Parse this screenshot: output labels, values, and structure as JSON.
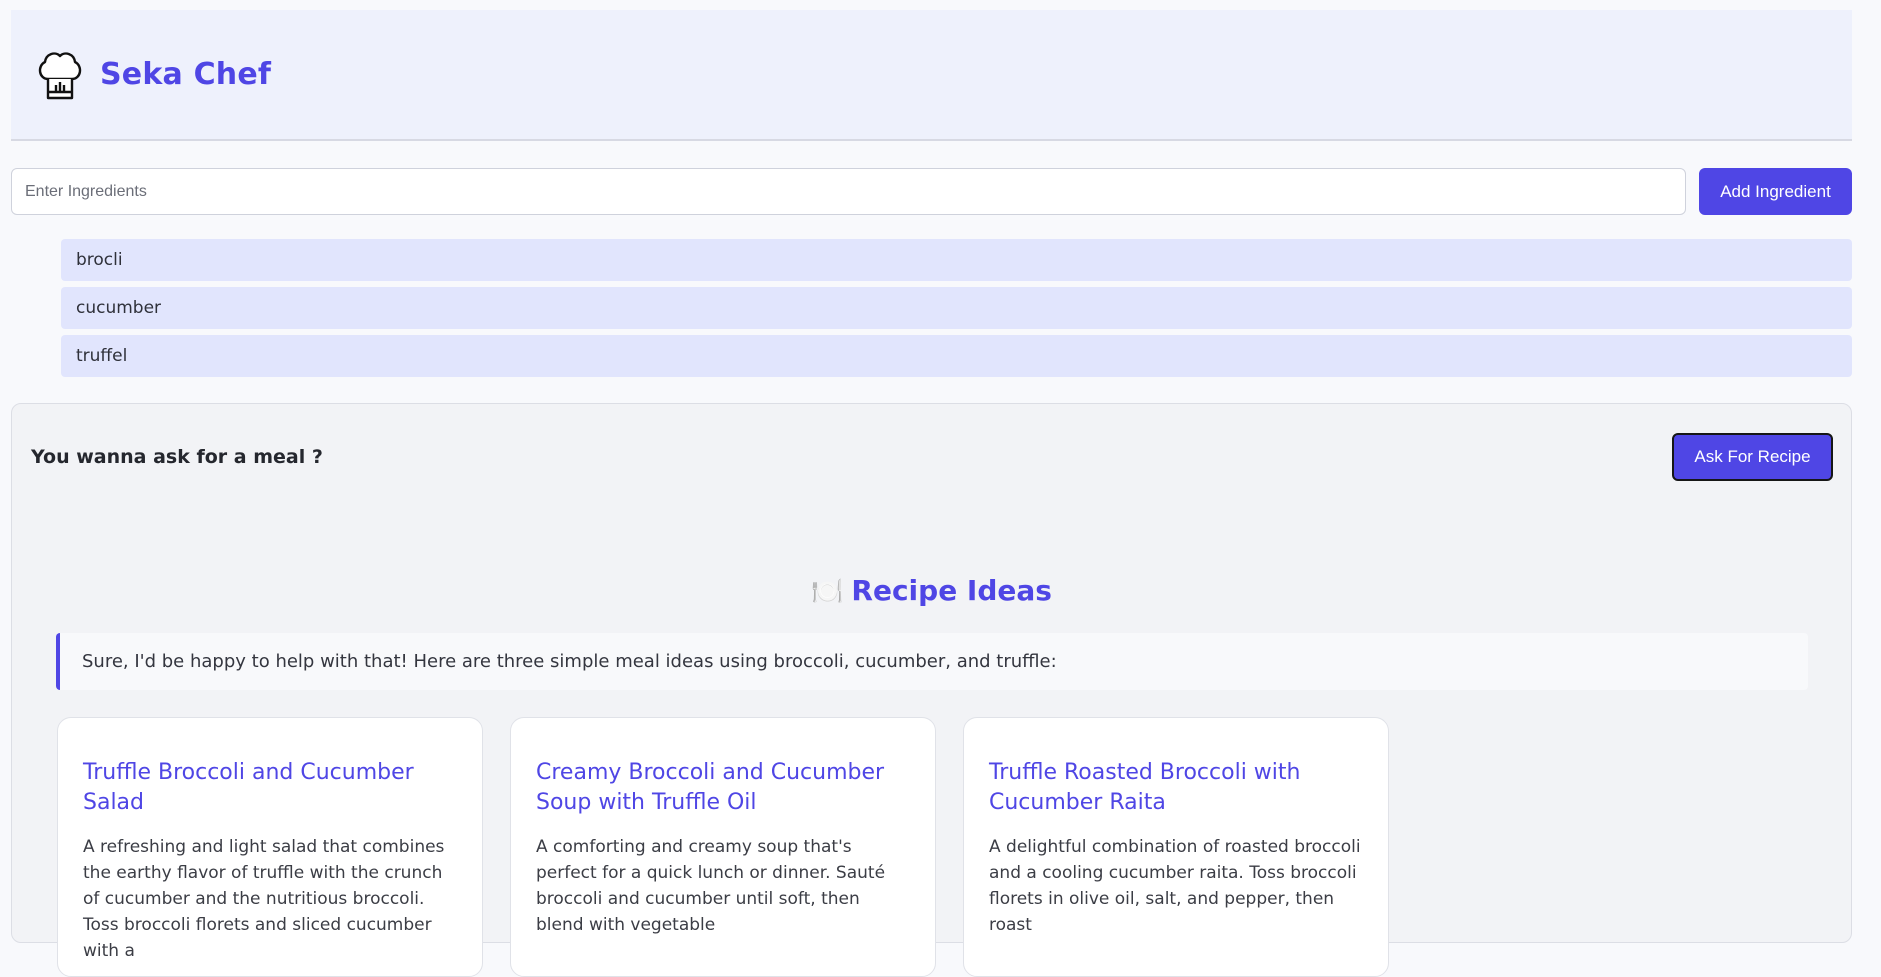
{
  "header": {
    "brand": "Seka Chef",
    "logo_icon": "chef-hat-icon"
  },
  "search": {
    "placeholder": "Enter Ingredients",
    "value": "",
    "add_label": "Add Ingredient"
  },
  "ingredients": [
    {
      "label": "brocli"
    },
    {
      "label": "cucumber"
    },
    {
      "label": "truffel"
    }
  ],
  "ask": {
    "prompt": "You wanna ask for a meal ?",
    "button_label": "Ask For Recipe"
  },
  "recipes": {
    "title": "Recipe Ideas",
    "title_icon": "🍽️",
    "intro": "Sure, I'd be happy to help with that! Here are three simple meal ideas using broccoli, cucumber, and truffle:",
    "cards": [
      {
        "title": "Truffle Broccoli and Cucumber Salad",
        "description": "A refreshing and light salad that combines the earthy flavor of truffle with the crunch of cucumber and the nutritious broccoli. Toss broccoli florets and sliced cucumber with a"
      },
      {
        "title": "Creamy Broccoli and Cucumber Soup with Truffle Oil",
        "description": "A comforting and creamy soup that's perfect for a quick lunch or dinner. Sauté broccoli and cucumber until soft, then blend with vegetable"
      },
      {
        "title": "Truffle Roasted Broccoli with Cucumber Raita",
        "description": "A delightful combination of roasted broccoli and a cooling cucumber raita. Toss broccoli florets in olive oil, salt, and pepper, then roast"
      }
    ]
  },
  "colors": {
    "accent": "#4f46e5",
    "header_bg": "#eef1fc",
    "ingredient_bg": "#e1e5fd"
  }
}
